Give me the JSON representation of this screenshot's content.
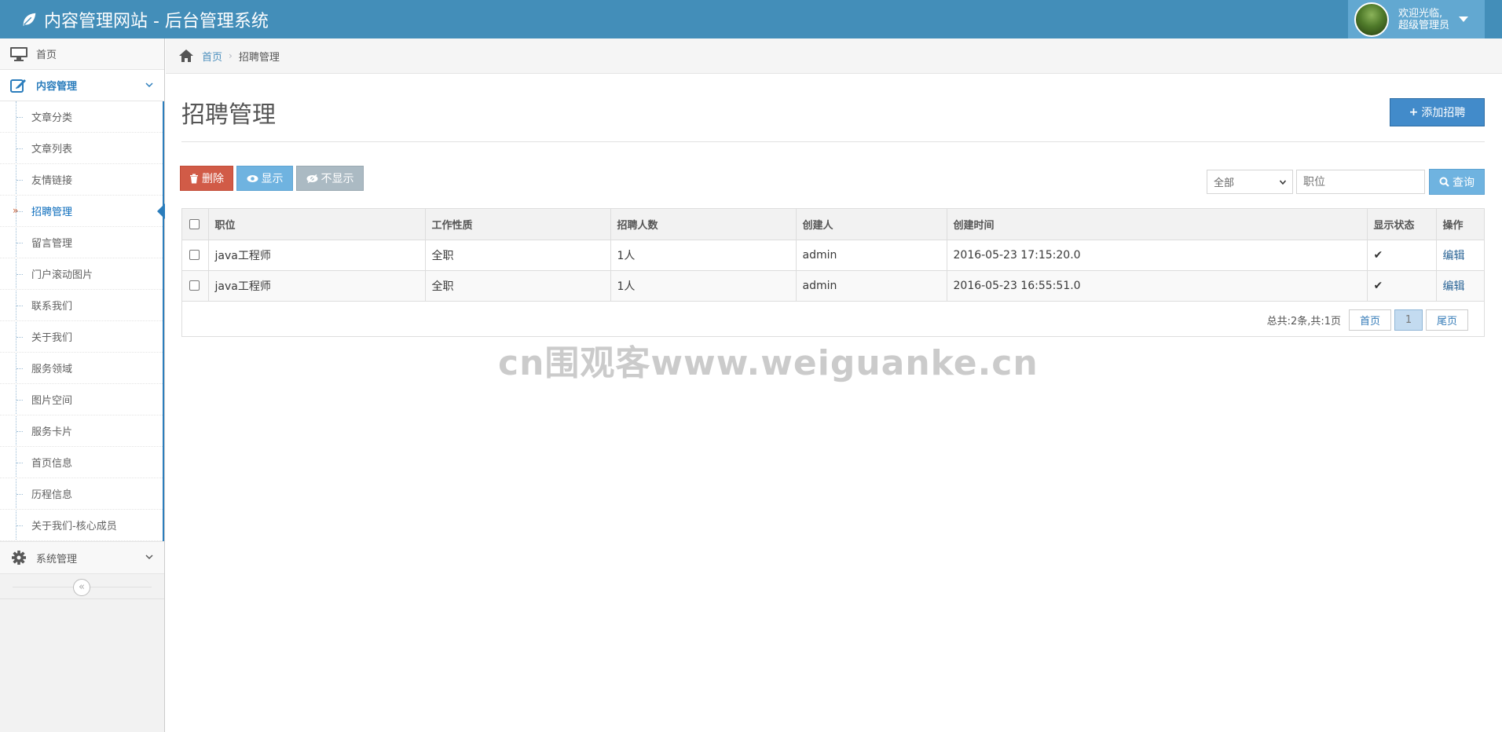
{
  "header": {
    "title": "内容管理网站 - 后台管理系统",
    "welcome": "欢迎光临,",
    "role": "超级管理员"
  },
  "sidebar": {
    "home": "首页",
    "content_menu": "内容管理",
    "items": [
      "文章分类",
      "文章列表",
      "友情链接",
      "招聘管理",
      "留言管理",
      "门户滚动图片",
      "联系我们",
      "关于我们",
      "服务领域",
      "图片空间",
      "服务卡片",
      "首页信息",
      "历程信息",
      "关于我们-核心成员"
    ],
    "active_item": "招聘管理",
    "system_menu": "系统管理",
    "collapse_icon": "«"
  },
  "breadcrumb": {
    "home": "首页",
    "current": "招聘管理"
  },
  "page": {
    "title": "招聘管理",
    "add_button": "添加招聘"
  },
  "toolbar": {
    "delete_label": "删除",
    "show_label": "显示",
    "hide_label": "不显示",
    "filter_selected": "全部",
    "search_placeholder": "职位",
    "query_label": "查询"
  },
  "table": {
    "headers": [
      "职位",
      "工作性质",
      "招聘人数",
      "创建人",
      "创建时间",
      "显示状态",
      "操作"
    ],
    "rows": [
      {
        "position": "java工程师",
        "type": "全职",
        "count": "1人",
        "creator": "admin",
        "created": "2016-05-23 17:15:20.0",
        "status": "✔",
        "action": "编辑"
      },
      {
        "position": "java工程师",
        "type": "全职",
        "count": "1人",
        "creator": "admin",
        "created": "2016-05-23 16:55:51.0",
        "status": "✔",
        "action": "编辑"
      }
    ]
  },
  "pager": {
    "total": "总共:2条,共:1页",
    "first": "首页",
    "current": "1",
    "last": "尾页"
  },
  "watermark": "cn围观客www.weiguanke.cn",
  "colors": {
    "navbar": "#438eb9",
    "accent": "#2b7dbc",
    "danger": "#d15b47",
    "info": "#6fb3e0",
    "grey": "#abbac3",
    "primary": "#428bca"
  }
}
